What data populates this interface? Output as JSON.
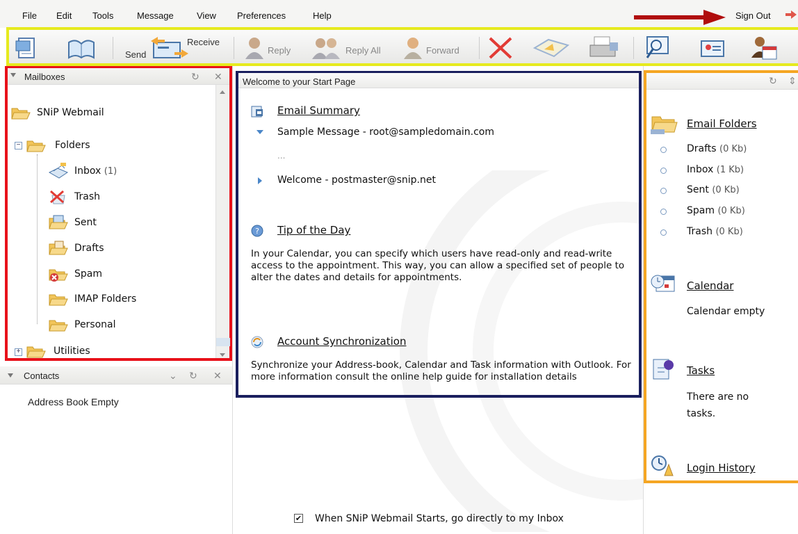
{
  "menu": {
    "items": [
      "File",
      "Edit",
      "Tools",
      "Message",
      "View",
      "Preferences",
      "Help"
    ],
    "sign_out": "Sign Out"
  },
  "toolbar": {
    "send": "Send",
    "receive": "Receive",
    "reply": "Reply",
    "reply_all": "Reply All",
    "forward": "Forward"
  },
  "mailboxes": {
    "title": "Mailboxes",
    "root": "SNiP Webmail",
    "folders_label": "Folders",
    "items": [
      {
        "label": "Inbox",
        "count": "(1)"
      },
      {
        "label": "Trash",
        "count": ""
      },
      {
        "label": "Sent",
        "count": ""
      },
      {
        "label": "Drafts",
        "count": ""
      },
      {
        "label": "Spam",
        "count": ""
      },
      {
        "label": "IMAP Folders",
        "count": ""
      },
      {
        "label": "Personal",
        "count": ""
      }
    ],
    "utilities": "Utilities"
  },
  "contacts": {
    "title": "Contacts",
    "empty": "Address Book Empty"
  },
  "start_page": {
    "title": "Welcome to your Start Page",
    "email_summary": {
      "title": "Email Summary",
      "messages": [
        "Sample Message - root@sampledomain.com",
        "Welcome - postmaster@snip.net"
      ],
      "ellipsis": "..."
    },
    "tip": {
      "title": "Tip of the Day",
      "text": "In your Calendar, you can specify which users have read-only and read-write access to the appointment. This way, you can allow a specified set of people to alter the dates and details for appointments."
    },
    "sync": {
      "title": "Account Synchronization",
      "text": "Synchronize your Address-book, Calendar and Task information with Outlook. For more information consult the online help guide for installation details"
    },
    "startup_option": "When SNiP Webmail Starts, go directly to my Inbox"
  },
  "right_panel": {
    "email_folders": {
      "title": "Email Folders",
      "items": [
        {
          "label": "Drafts",
          "size": "(0 Kb)"
        },
        {
          "label": "Inbox",
          "size": "(1 Kb)"
        },
        {
          "label": "Sent",
          "size": "(0 Kb)"
        },
        {
          "label": "Spam",
          "size": "(0 Kb)"
        },
        {
          "label": "Trash",
          "size": "(0 Kb)"
        }
      ]
    },
    "calendar": {
      "title": "Calendar",
      "text": "Calendar empty"
    },
    "tasks": {
      "title": "Tasks",
      "text": "There are no tasks."
    },
    "login_history": {
      "title": "Login History"
    }
  },
  "colors": {
    "mailboxes_highlight": "#e8111a",
    "toolbar_highlight": "#e6ea1e",
    "start_highlight": "#1a1f5e",
    "right_highlight": "#f5a623",
    "arrow": "#b00d0d"
  },
  "icons": [
    "folder-icon",
    "inbox-icon",
    "trash-icon",
    "sent-icon",
    "drafts-icon",
    "spam-icon",
    "refresh-icon",
    "close-icon",
    "tip-icon",
    "sync-icon",
    "calendar-icon",
    "tasks-icon",
    "login-history-icon"
  ]
}
